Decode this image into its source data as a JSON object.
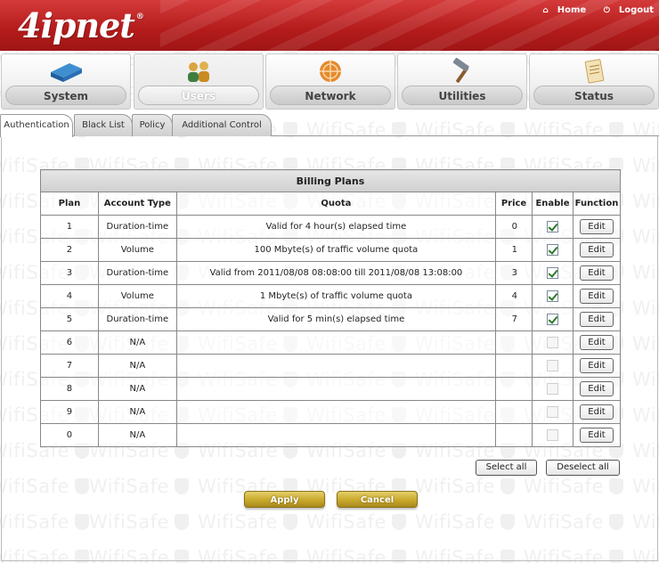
{
  "header": {
    "logo": "4ipnet",
    "logo_mark": "®",
    "links": {
      "home": "Home",
      "logout": "Logout"
    }
  },
  "watermark": {
    "text": "WifiSafe"
  },
  "nav": {
    "items": [
      {
        "label": "System",
        "icon": "network-device-icon"
      },
      {
        "label": "Users",
        "icon": "users-icon",
        "active": true
      },
      {
        "label": "Network",
        "icon": "network-globe-icon"
      },
      {
        "label": "Utilities",
        "icon": "hammer-icon"
      },
      {
        "label": "Status",
        "icon": "report-icon"
      }
    ]
  },
  "tabs": {
    "items": [
      {
        "label": "Authentication",
        "active": true
      },
      {
        "label": "Black List"
      },
      {
        "label": "Policy"
      },
      {
        "label": "Additional Control"
      }
    ]
  },
  "billing": {
    "title": "Billing Plans",
    "columns": {
      "plan": "Plan",
      "account_type": "Account Type",
      "quota": "Quota",
      "price": "Price",
      "enable": "Enable",
      "function": "Function"
    },
    "rows": [
      {
        "plan": "1",
        "account_type": "Duration-time",
        "quota": "Valid for 4 hour(s) elapsed time",
        "price": "0",
        "enabled": true,
        "edit": "Edit"
      },
      {
        "plan": "2",
        "account_type": "Volume",
        "quota": "100 Mbyte(s) of traffic volume quota",
        "price": "1",
        "enabled": true,
        "edit": "Edit"
      },
      {
        "plan": "3",
        "account_type": "Duration-time",
        "quota": "Valid from 2011/08/08 08:08:00 till 2011/08/08 13:08:00",
        "price": "3",
        "enabled": true,
        "edit": "Edit"
      },
      {
        "plan": "4",
        "account_type": "Volume",
        "quota": "1 Mbyte(s) of traffic volume quota",
        "price": "4",
        "enabled": true,
        "edit": "Edit"
      },
      {
        "plan": "5",
        "account_type": "Duration-time",
        "quota": "Valid for 5 min(s) elapsed time",
        "price": "7",
        "enabled": true,
        "edit": "Edit"
      },
      {
        "plan": "6",
        "account_type": "N/A",
        "quota": "",
        "price": "",
        "enabled": false,
        "disabled": true,
        "edit": "Edit"
      },
      {
        "plan": "7",
        "account_type": "N/A",
        "quota": "",
        "price": "",
        "enabled": false,
        "disabled": true,
        "edit": "Edit"
      },
      {
        "plan": "8",
        "account_type": "N/A",
        "quota": "",
        "price": "",
        "enabled": false,
        "disabled": true,
        "edit": "Edit"
      },
      {
        "plan": "9",
        "account_type": "N/A",
        "quota": "",
        "price": "",
        "enabled": false,
        "disabled": true,
        "edit": "Edit"
      },
      {
        "plan": "0",
        "account_type": "N/A",
        "quota": "",
        "price": "",
        "enabled": false,
        "disabled": true,
        "edit": "Edit"
      }
    ]
  },
  "actions": {
    "select_all": "Select all",
    "deselect_all": "Deselect all",
    "apply": "Apply",
    "cancel": "Cancel"
  },
  "colors": {
    "header_red": "#b31b1b",
    "button_gold": "#c9a92c",
    "check_green": "#2b7a2b"
  }
}
